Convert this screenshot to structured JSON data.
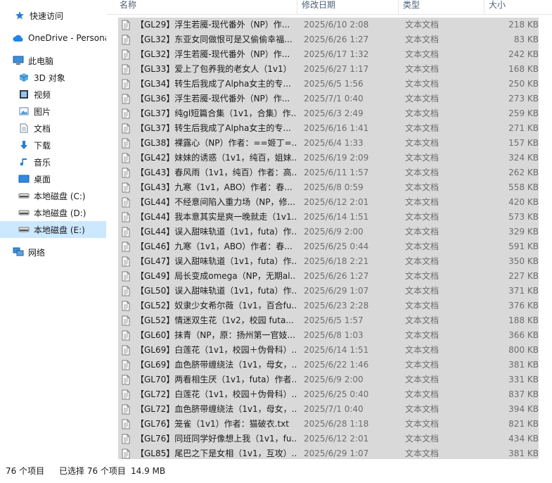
{
  "colors": {
    "selection": "#d9d9d9",
    "nav_selected": "#cce8ff",
    "header_text": "#4c607a",
    "secondary_text": "#6d6d6d"
  },
  "header": {
    "name": "名称",
    "date": "修改日期",
    "type": "类型",
    "size": "大小"
  },
  "nav": {
    "items": [
      {
        "icon": "pin-star-icon",
        "label": "快速访问"
      },
      {
        "icon": "cloud-icon",
        "label": "OneDrive - Persona"
      },
      {
        "icon": "computer-icon",
        "label": "此电脑"
      },
      {
        "icon": "cube-3d-icon",
        "label": "3D 对象"
      },
      {
        "icon": "video-icon",
        "label": "视频"
      },
      {
        "icon": "picture-icon",
        "label": "图片"
      },
      {
        "icon": "document-icon",
        "label": "文档"
      },
      {
        "icon": "download-arrow-icon",
        "label": "下载"
      },
      {
        "icon": "music-note-icon",
        "label": "音乐"
      },
      {
        "icon": "desktop-icon",
        "label": "桌面"
      },
      {
        "icon": "drive-icon",
        "label": "本地磁盘 (C:)"
      },
      {
        "icon": "drive-icon",
        "label": "本地磁盘 (D:)"
      },
      {
        "icon": "drive-icon",
        "label": "本地磁盘 (E:)"
      },
      {
        "icon": "network-icon",
        "label": "网络"
      }
    ]
  },
  "files": [
    {
      "name": "【GL29】浮生若魇-现代番外（NP）作...",
      "date": "2025/6/10 2:08",
      "type": "文本文档",
      "size": "218 KB"
    },
    {
      "name": "【GL32】东亚女同做恨可是又偷偷幸福...",
      "date": "2025/6/26 1:27",
      "type": "文本文档",
      "size": "83 KB"
    },
    {
      "name": "【GL32】浮生若魇-现代番外（NP）作...",
      "date": "2025/6/17 1:32",
      "type": "文本文档",
      "size": "242 KB"
    },
    {
      "name": "【GL33】爱上了包养我的老女人（1v1）",
      "date": "2025/6/27 1:17",
      "type": "文本文档",
      "size": "168 KB"
    },
    {
      "name": "【GL34】转生后我成了Alpha女主的专...",
      "date": "2025/6/5 1:56",
      "type": "文本文档",
      "size": "250 KB"
    },
    {
      "name": "【GL36】浮生若魇-现代番外（NP）作...",
      "date": "2025/7/1 0:40",
      "type": "文本文档",
      "size": "273 KB"
    },
    {
      "name": "【GL37】纯gl短篇合集（1v1，合集）作...",
      "date": "2025/6/3 2:49",
      "type": "文本文档",
      "size": "259 KB"
    },
    {
      "name": "【GL37】转生后我成了Alpha女主的专...",
      "date": "2025/6/16 1:41",
      "type": "文本文档",
      "size": "271 KB"
    },
    {
      "name": "【GL38】裸露心（NP）作者：==姬丁=...",
      "date": "2025/6/4 1:33",
      "type": "文本文档",
      "size": "157 KB"
    },
    {
      "name": "【GL42】妹妹的诱惑（1v1，纯百，姐妹...",
      "date": "2025/6/19 2:09",
      "type": "文本文档",
      "size": "324 KB"
    },
    {
      "name": "【GL43】春风雨（1v1，纯百）作者：高...",
      "date": "2025/6/11 1:57",
      "type": "文本文档",
      "size": "262 KB"
    },
    {
      "name": "【GL43】九寒（1v1，ABO）作者：春...",
      "date": "2025/6/8 0:59",
      "type": "文本文档",
      "size": "558 KB"
    },
    {
      "name": "【GL44】不经意间陷入重力场（NP，修...",
      "date": "2025/6/12 2:01",
      "type": "文本文档",
      "size": "420 KB"
    },
    {
      "name": "【GL44】我本意其实是爽一晚就走（1v1...",
      "date": "2025/6/14 1:51",
      "type": "文本文档",
      "size": "573 KB"
    },
    {
      "name": "【GL44】误入甜味轨道（1v1，futa）作...",
      "date": "2025/6/9 2:00",
      "type": "文本文档",
      "size": "329 KB"
    },
    {
      "name": "【GL46】九寒（1v1，ABO）作者：春...",
      "date": "2025/6/25 0:44",
      "type": "文本文档",
      "size": "591 KB"
    },
    {
      "name": "【GL47】误入甜味轨道（1v1，futa）作...",
      "date": "2025/6/18 2:21",
      "type": "文本文档",
      "size": "350 KB"
    },
    {
      "name": "【GL49】局长变成omega（NP，无期al...",
      "date": "2025/6/26 1:27",
      "type": "文本文档",
      "size": "227 KB"
    },
    {
      "name": "【GL50】误入甜味轨道（1v1，futa）作...",
      "date": "2025/6/29 1:07",
      "type": "文本文档",
      "size": "371 KB"
    },
    {
      "name": "【GL52】奴隶少女希尔薇（1v1，百合fu...",
      "date": "2025/6/23 2:28",
      "type": "文本文档",
      "size": "376 KB"
    },
    {
      "name": "【GL52】情迷双生花（1v2，校园 futa...",
      "date": "2025/6/5 1:57",
      "type": "文本文档",
      "size": "188 KB"
    },
    {
      "name": "【GL60】抹青（NP，原：扬州第一官妓...",
      "date": "2025/6/8 1:03",
      "type": "文本文档",
      "size": "366 KB"
    },
    {
      "name": "【GL69】白莲花（1v1，校园＋伪骨科）...",
      "date": "2025/6/14 1:51",
      "type": "文本文档",
      "size": "800 KB"
    },
    {
      "name": "【GL69】血色脐带缠绕法（1v1，母女，...",
      "date": "2025/6/22 1:46",
      "type": "文本文档",
      "size": "381 KB"
    },
    {
      "name": "【GL70】两看相生厌（1v1，futa）作者...",
      "date": "2025/6/9 2:00",
      "type": "文本文档",
      "size": "331 KB"
    },
    {
      "name": "【GL72】白莲花（1v1，校园＋伪骨科）...",
      "date": "2025/6/25 0:40",
      "type": "文本文档",
      "size": "837 KB"
    },
    {
      "name": "【GL72】血色脐带缠绕法（1v1，母女，...",
      "date": "2025/7/1 0:40",
      "type": "文本文档",
      "size": "394 KB"
    },
    {
      "name": "【GL76】笼雀（1v1）作者：猫破衣.txt",
      "date": "2025/6/28 1:18",
      "type": "文本文档",
      "size": "821 KB"
    },
    {
      "name": "【GL76】同班同学好像想上我（1v1，fu...",
      "date": "2025/6/12 2:01",
      "type": "文本文档",
      "size": "434 KB"
    },
    {
      "name": "【GL85】尾巴之下是女相（1v1，互攻）...",
      "date": "2025/6/29 1:07",
      "type": "文本文档",
      "size": "381 KB"
    }
  ],
  "status": {
    "item_count": "76 个项目",
    "selected": "已选择 76 个项目",
    "selected_size": "14.9 MB"
  }
}
